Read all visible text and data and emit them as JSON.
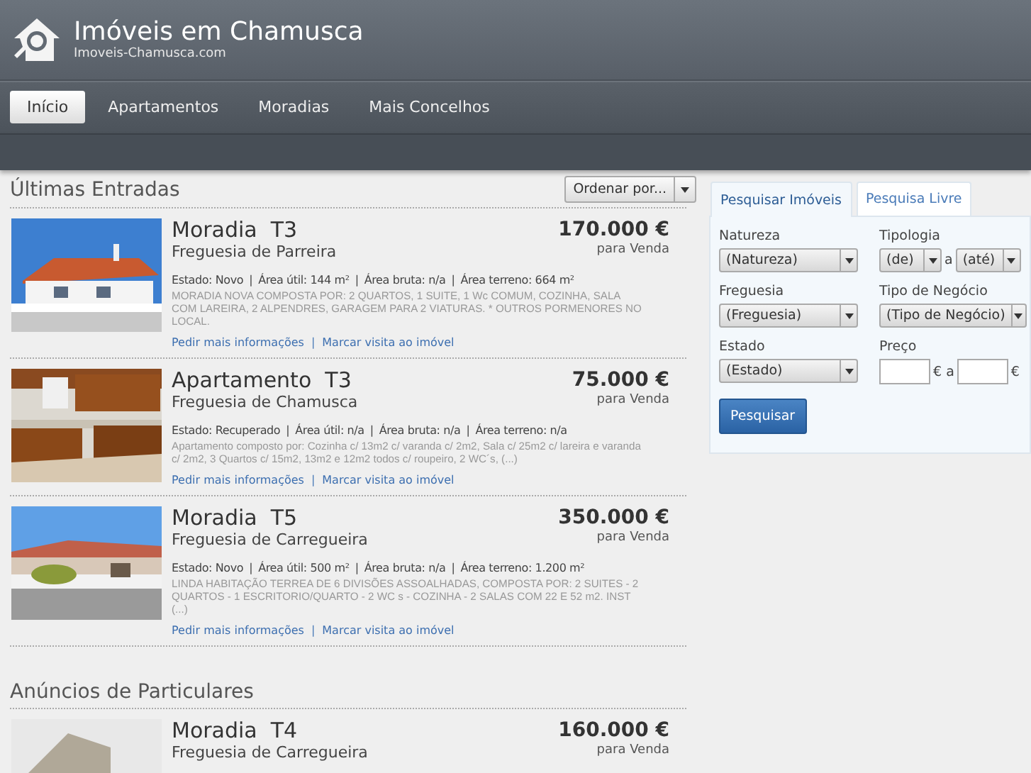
{
  "site": {
    "title": "Imóveis em Chamusca",
    "subtitle": "Imoveis-Chamusca.com"
  },
  "nav": [
    {
      "label": "Início",
      "selected": true
    },
    {
      "label": "Apartamentos",
      "selected": false
    },
    {
      "label": "Moradias",
      "selected": false
    },
    {
      "label": "Mais Concelhos",
      "selected": false
    }
  ],
  "separator": "|",
  "sections": [
    {
      "title": "Últimas Entradas",
      "sort_button": "Ordenar por...",
      "listings": [
        {
          "picture": {
            "kind": "picture"
          },
          "type": "Moradia",
          "typology": "T3",
          "parish": "Freguesia de Parreira",
          "price": "170.000 €",
          "deal": "para Venda",
          "details": [
            "Estado: Novo",
            "Área útil: 144 m²",
            "Área bruta: n/a",
            "Área terreno: 664 m²"
          ],
          "description": "MORADIA NOVA COMPOSTA POR: 2 QUARTOS, 1 SUITE, 1 Wc COMUM, COZINHA, SALA COM LAREIRA, 2 ALPENDRES, GARAGEM PARA 2 VIATURAS. * OUTROS PORMENORES NO LOCAL.",
          "links": [
            "Pedir mais informações",
            "Marcar visita ao imóvel"
          ]
        },
        {
          "picture": {
            "kind": "picture"
          },
          "type": "Apartamento",
          "typology": "T3",
          "parish": "Freguesia de Chamusca",
          "price": "75.000 €",
          "deal": "para Venda",
          "details": [
            "Estado: Recuperado",
            "Área útil: n/a",
            "Área bruta: n/a",
            "Área terreno: n/a"
          ],
          "description": "Apartamento composto por: Cozinha c/ 13m2 c/ varanda c/ 2m2, Sala c/ 25m2 c/ lareira e varanda c/ 2m2, 3 Quartos c/ 15m2, 13m2 e 12m2 todos c/ roupeiro, 2 WC´s, (...)",
          "links": [
            "Pedir mais informações",
            "Marcar visita ao imóvel"
          ]
        },
        {
          "picture": {
            "kind": "picture"
          },
          "type": "Moradia",
          "typology": "T5",
          "parish": "Freguesia de Carregueira",
          "price": "350.000 €",
          "deal": "para Venda",
          "details": [
            "Estado: Novo",
            "Área útil: 500 m²",
            "Área bruta: n/a",
            "Área terreno: 1.200 m²"
          ],
          "description": "LINDA HABITAÇÃO TERREA DE 6 DIVISÕES ASSOALHADAS, COMPOSTA POR: 2 SUITES - 2 QUARTOS - 1 ESCRITORIO/QUARTO - 2 WC s - COZINHA - 2 SALAS COM 22 E 52 m2. INST (...)",
          "links": [
            "Pedir mais informações",
            "Marcar visita ao imóvel"
          ]
        }
      ]
    },
    {
      "title": "Anúncios de Particulares",
      "listings": [
        {
          "picture": {
            "kind": "picture"
          },
          "type": "Moradia",
          "typology": "T4",
          "parish": "Freguesia de Carregueira",
          "price": "160.000 €",
          "deal": "para Venda"
        }
      ]
    }
  ],
  "search": {
    "tabs": [
      {
        "label": "Pesquisar Imóveis",
        "selected": true
      },
      {
        "label": "Pesquisa Livre",
        "selected": false
      }
    ],
    "fields": [
      {
        "kind": "select",
        "label": "Natureza",
        "value": "(Natureza)"
      },
      {
        "kind": "range",
        "label": "Tipologia",
        "from": "(de)",
        "joiner": "a",
        "to": "(até)"
      },
      {
        "kind": "select",
        "label": "Freguesia",
        "value": "(Freguesia)"
      },
      {
        "kind": "select",
        "label": "Tipo de Negócio",
        "value": "(Tipo de Negócio)"
      },
      {
        "kind": "select",
        "label": "Estado",
        "value": "(Estado)"
      },
      {
        "kind": "price",
        "label": "Preço",
        "unit": "€",
        "joiner": "a"
      }
    ],
    "button": "Pesquisar"
  }
}
